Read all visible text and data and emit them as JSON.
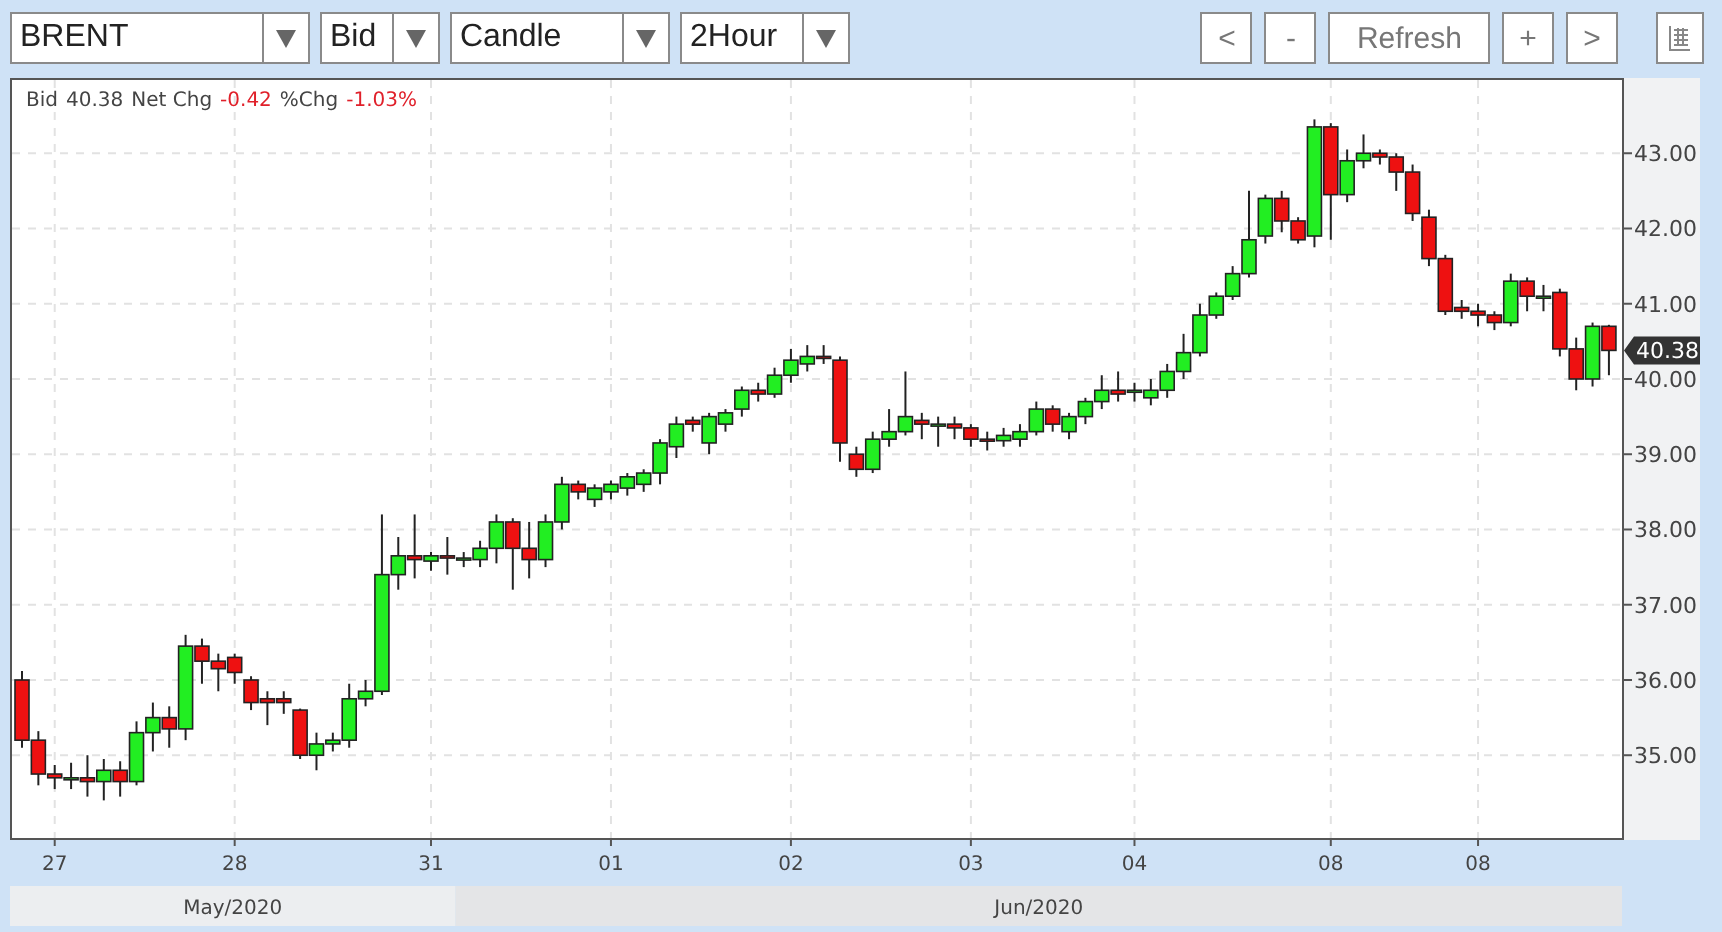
{
  "toolbar": {
    "selects": [
      {
        "value": "BRENT"
      },
      {
        "value": "Bid"
      },
      {
        "value": "Candle"
      },
      {
        "value": "2Hour"
      }
    ],
    "buttons": [
      {
        "label": "<"
      },
      {
        "label": "-"
      },
      {
        "label": "Refresh"
      },
      {
        "label": "+"
      },
      {
        "label": ">"
      }
    ]
  },
  "quote": [
    {
      "label": "Bid",
      "value": "40.38",
      "negative": false
    },
    {
      "label": "Net Chg",
      "value": "-0.42",
      "negative": true
    },
    {
      "label": "%Chg",
      "value": "-1.03%",
      "negative": true
    }
  ],
  "last_price": "40.38",
  "months": [
    {
      "label": "May/2020"
    },
    {
      "label": "Jun/2020"
    }
  ],
  "chart_data": {
    "type": "candlestick",
    "grid": true,
    "ylim": [
      33.9,
      44.0
    ],
    "yticks": [
      {
        "value": 35,
        "label": "35.00"
      },
      {
        "value": 36,
        "label": "36.00"
      },
      {
        "value": 37,
        "label": "37.00"
      },
      {
        "value": 38,
        "label": "38.00"
      },
      {
        "value": 39,
        "label": "39.00"
      },
      {
        "value": 40,
        "label": "40.00"
      },
      {
        "value": 41,
        "label": "41.00"
      },
      {
        "value": 42,
        "label": "42.00"
      },
      {
        "value": 43,
        "label": "43.00"
      }
    ],
    "categories": [
      null,
      null,
      "27",
      null,
      null,
      null,
      null,
      null,
      null,
      null,
      null,
      null,
      null,
      "28",
      null,
      null,
      null,
      null,
      null,
      null,
      null,
      null,
      null,
      null,
      null,
      "31",
      null,
      null,
      null,
      null,
      null,
      null,
      null,
      null,
      null,
      null,
      "01",
      null,
      null,
      null,
      null,
      null,
      null,
      null,
      null,
      null,
      null,
      "02",
      null,
      null,
      null,
      null,
      null,
      null,
      null,
      null,
      null,
      null,
      "03",
      null,
      null,
      null,
      null,
      null,
      null,
      null,
      null,
      null,
      "04",
      null,
      null,
      null,
      null,
      null,
      null,
      null,
      null,
      null,
      null,
      null,
      "08",
      null,
      null,
      null,
      null,
      null,
      null,
      null,
      null,
      "08",
      null,
      null,
      null,
      null,
      null,
      null,
      null,
      null
    ],
    "ohlc": [
      [
        36.0,
        36.12,
        35.1,
        35.2
      ],
      [
        35.2,
        35.32,
        34.6,
        34.75
      ],
      [
        34.75,
        34.87,
        34.55,
        34.7
      ],
      [
        34.7,
        34.9,
        34.55,
        34.7
      ],
      [
        34.7,
        35.0,
        34.45,
        34.65
      ],
      [
        34.65,
        34.95,
        34.4,
        34.8
      ],
      [
        34.8,
        34.92,
        34.45,
        34.65
      ],
      [
        34.65,
        35.45,
        34.6,
        35.3
      ],
      [
        35.3,
        35.7,
        35.05,
        35.5
      ],
      [
        35.5,
        35.65,
        35.1,
        35.35
      ],
      [
        35.35,
        36.6,
        35.2,
        36.45
      ],
      [
        36.45,
        36.55,
        35.95,
        36.25
      ],
      [
        36.25,
        36.35,
        35.85,
        36.15
      ],
      [
        36.3,
        36.35,
        35.95,
        36.1
      ],
      [
        36.0,
        36.05,
        35.6,
        35.7
      ],
      [
        35.75,
        35.85,
        35.4,
        35.7
      ],
      [
        35.75,
        35.85,
        35.55,
        35.7
      ],
      [
        35.6,
        35.62,
        34.95,
        35.0
      ],
      [
        35.0,
        35.3,
        34.8,
        35.15
      ],
      [
        35.15,
        35.3,
        35.05,
        35.2
      ],
      [
        35.2,
        35.95,
        35.1,
        35.75
      ],
      [
        35.75,
        36.0,
        35.65,
        35.85
      ],
      [
        35.85,
        38.2,
        35.8,
        37.4
      ],
      [
        37.4,
        37.9,
        37.2,
        37.65
      ],
      [
        37.65,
        38.2,
        37.35,
        37.6
      ],
      [
        37.58,
        37.7,
        37.45,
        37.65
      ],
      [
        37.65,
        37.9,
        37.4,
        37.62
      ],
      [
        37.62,
        37.7,
        37.5,
        37.62
      ],
      [
        37.6,
        37.85,
        37.5,
        37.75
      ],
      [
        37.75,
        38.2,
        37.55,
        38.1
      ],
      [
        38.1,
        38.15,
        37.2,
        37.75
      ],
      [
        37.75,
        38.1,
        37.35,
        37.6
      ],
      [
        37.6,
        38.2,
        37.5,
        38.1
      ],
      [
        38.1,
        38.7,
        38.0,
        38.6
      ],
      [
        38.6,
        38.65,
        38.4,
        38.5
      ],
      [
        38.4,
        38.6,
        38.3,
        38.55
      ],
      [
        38.5,
        38.65,
        38.4,
        38.6
      ],
      [
        38.55,
        38.75,
        38.45,
        38.7
      ],
      [
        38.6,
        38.8,
        38.5,
        38.75
      ],
      [
        38.75,
        39.2,
        38.6,
        39.15
      ],
      [
        39.1,
        39.5,
        38.95,
        39.4
      ],
      [
        39.45,
        39.5,
        39.3,
        39.4
      ],
      [
        39.15,
        39.55,
        39.0,
        39.5
      ],
      [
        39.4,
        39.6,
        39.3,
        39.55
      ],
      [
        39.6,
        39.9,
        39.5,
        39.85
      ],
      [
        39.85,
        39.95,
        39.7,
        39.8
      ],
      [
        39.8,
        40.15,
        39.75,
        40.05
      ],
      [
        40.05,
        40.4,
        39.95,
        40.25
      ],
      [
        40.2,
        40.45,
        40.1,
        40.3
      ],
      [
        40.3,
        40.45,
        40.2,
        40.28
      ],
      [
        40.25,
        40.3,
        38.9,
        39.15
      ],
      [
        39.0,
        39.1,
        38.7,
        38.8
      ],
      [
        38.8,
        39.3,
        38.75,
        39.2
      ],
      [
        39.2,
        39.6,
        39.1,
        39.3
      ],
      [
        39.3,
        40.1,
        39.25,
        39.5
      ],
      [
        39.45,
        39.55,
        39.2,
        39.4
      ],
      [
        39.4,
        39.5,
        39.1,
        39.4
      ],
      [
        39.4,
        39.5,
        39.2,
        39.35
      ],
      [
        39.35,
        39.4,
        39.1,
        39.2
      ],
      [
        39.2,
        39.3,
        39.05,
        39.18
      ],
      [
        39.18,
        39.35,
        39.1,
        39.25
      ],
      [
        39.2,
        39.4,
        39.1,
        39.3
      ],
      [
        39.3,
        39.7,
        39.25,
        39.6
      ],
      [
        39.6,
        39.65,
        39.3,
        39.4
      ],
      [
        39.3,
        39.55,
        39.2,
        39.5
      ],
      [
        39.5,
        39.75,
        39.4,
        39.7
      ],
      [
        39.7,
        40.05,
        39.6,
        39.85
      ],
      [
        39.85,
        40.1,
        39.7,
        39.8
      ],
      [
        39.85,
        39.95,
        39.7,
        39.85
      ],
      [
        39.75,
        40.0,
        39.65,
        39.85
      ],
      [
        39.85,
        40.2,
        39.75,
        40.1
      ],
      [
        40.1,
        40.6,
        40.0,
        40.35
      ],
      [
        40.35,
        41.0,
        40.3,
        40.85
      ],
      [
        40.85,
        41.15,
        40.8,
        41.1
      ],
      [
        41.1,
        41.5,
        41.05,
        41.4
      ],
      [
        41.4,
        42.5,
        41.35,
        41.85
      ],
      [
        41.9,
        42.45,
        41.8,
        42.4
      ],
      [
        42.4,
        42.5,
        41.95,
        42.1
      ],
      [
        42.1,
        42.15,
        41.8,
        41.85
      ],
      [
        41.9,
        43.45,
        41.75,
        43.35
      ],
      [
        43.35,
        43.4,
        41.85,
        42.45
      ],
      [
        42.45,
        43.05,
        42.35,
        42.9
      ],
      [
        42.9,
        43.25,
        42.8,
        43.0
      ],
      [
        43.0,
        43.05,
        42.85,
        42.95
      ],
      [
        42.95,
        43.0,
        42.5,
        42.75
      ],
      [
        42.75,
        42.85,
        42.1,
        42.2
      ],
      [
        42.15,
        42.25,
        41.5,
        41.6
      ],
      [
        41.6,
        41.65,
        40.85,
        40.9
      ],
      [
        40.95,
        41.05,
        40.8,
        40.9
      ],
      [
        40.9,
        41.0,
        40.7,
        40.85
      ],
      [
        40.85,
        40.9,
        40.65,
        40.75
      ],
      [
        40.75,
        41.4,
        40.7,
        41.3
      ],
      [
        41.3,
        41.35,
        40.9,
        41.1
      ],
      [
        41.1,
        41.25,
        40.9,
        41.1
      ],
      [
        41.15,
        41.2,
        40.3,
        40.4
      ],
      [
        40.4,
        40.55,
        39.85,
        40.0
      ],
      [
        40.0,
        40.75,
        39.9,
        40.7
      ],
      [
        40.7,
        40.72,
        40.05,
        40.38
      ]
    ]
  }
}
